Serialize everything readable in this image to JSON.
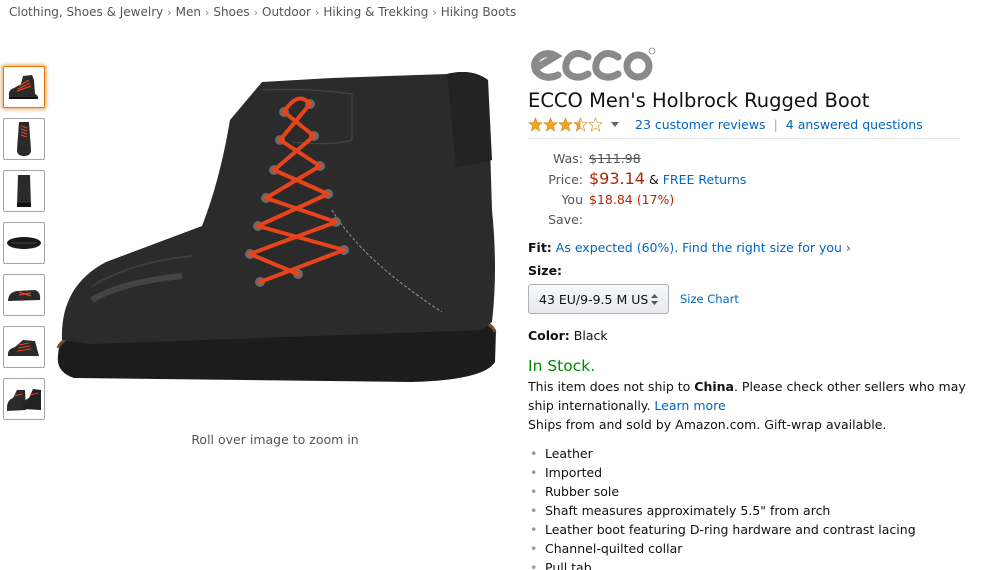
{
  "breadcrumb": [
    "Clothing, Shoes & Jewelry",
    "Men",
    "Shoes",
    "Outdoor",
    "Hiking & Trekking",
    "Hiking Boots"
  ],
  "thumbnails": [
    "side-view",
    "top-view",
    "back-view",
    "sole-view",
    "front-view",
    "angle-view",
    "pair-view"
  ],
  "zoom_hint": "Roll over image to zoom in",
  "brand": "ecco",
  "title": "ECCO Men's Holbrock Rugged Boot",
  "rating": {
    "stars": 3.5,
    "reviews": "23 customer reviews",
    "questions": "4 answered questions"
  },
  "pricing": {
    "was_label": "Was:",
    "was_value": "$111.98",
    "price_label": "Price:",
    "price_value": "$93.14",
    "amp": "&",
    "returns": "FREE Returns",
    "save_label": "You Save:",
    "save_value": "$18.84 (17%)"
  },
  "fit": {
    "label": "Fit:",
    "value": "As expected (60%). Find the right size for you ›"
  },
  "size": {
    "label": "Size:",
    "selected": "43 EU/9-9.5 M US",
    "chart": "Size Chart"
  },
  "color": {
    "label": "Color:",
    "value": "Black"
  },
  "stock": "In Stock.",
  "shipping": {
    "line1_a": "This item does not ship to ",
    "country": "China",
    "line1_b": ". Please check other sellers who may ship internationally. ",
    "learn_more": "Learn more",
    "line2": "Ships from and sold by Amazon.com. Gift-wrap available."
  },
  "features": [
    "Leather",
    "Imported",
    "Rubber sole",
    "Shaft measures approximately 5.5\" from arch",
    "Leather boot featuring D-ring hardware and contrast lacing",
    "Channel-quilted collar",
    "Pull tab"
  ],
  "colors": {
    "link": "#0066c0",
    "price": "#b12704",
    "stock": "#008a00",
    "star": "#f4a418"
  }
}
